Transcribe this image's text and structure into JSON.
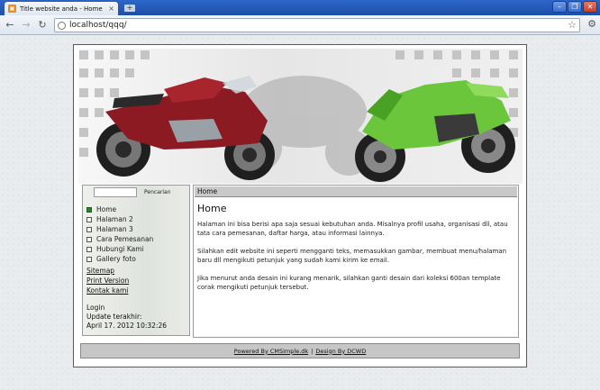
{
  "browser": {
    "tab_title": "Title website anda - Home",
    "tab_close": "×",
    "new_tab": "+",
    "url": "localhost/qqq/",
    "back": "←",
    "forward": "→",
    "reload": "↻",
    "star": "☆",
    "wrench": "🔧",
    "minimize": "–",
    "maximize": "❐",
    "close": "✕"
  },
  "sidebar": {
    "search_label": "Pencarian",
    "menu": [
      {
        "label": "Home",
        "active": true
      },
      {
        "label": "Halaman 2",
        "active": false
      },
      {
        "label": "Halaman 3",
        "active": false
      },
      {
        "label": "Cara Pemesanan",
        "active": false
      },
      {
        "label": "Hubungi Kami",
        "active": false
      },
      {
        "label": "Gallery foto",
        "active": false
      }
    ],
    "links": {
      "sitemap": "Sitemap",
      "print": "Print Version",
      "contact": "Kontak kami"
    },
    "login": "Login",
    "update_label": "Update terakhir:",
    "update_date": "April 17. 2012 10:32:26"
  },
  "content": {
    "breadcrumb": "Home",
    "title": "Home",
    "paragraphs": [
      "Halaman ini bisa berisi apa saja sesuai kebutuhan anda. Misalnya profil usaha, organisasi dll, atau tata cara pemesanan, daftar harga, atau informasi lainnya.",
      "Silahkan edit website ini seperti mengganti teks, memasukkan gambar, membuat menu/halaman baru dll mengikuti petunjuk yang sudah kami kirim ke email.",
      "Jika menurut anda desain ini kurang menarik, silahkan ganti desain dari koleksi 600an template corak mengikuti petunjuk tersebut."
    ]
  },
  "footer": {
    "powered": "Powered By CMSimple.dk",
    "separator": "|",
    "design": "Design By DCWD"
  },
  "colors": {
    "red_bike": "#8b1a22",
    "green_bike": "#6bc63c",
    "active_bullet": "#2f7d2f"
  }
}
